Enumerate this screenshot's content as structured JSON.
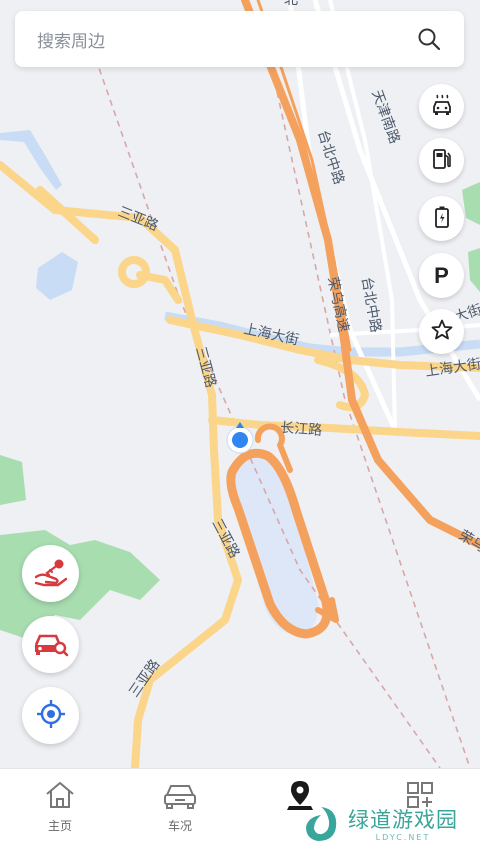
{
  "search": {
    "placeholder": "搜索周边",
    "icon": "search-icon"
  },
  "map": {
    "labels": {
      "tianjin_south": "天津南路",
      "taibei_mid_1": "台北中路",
      "taibei_mid_2": "台北中路",
      "rongwu_highway": "荣乌高速",
      "rongwu_short": "荣乌",
      "sanya_1": "三亚路",
      "sanya_2": "三亚路",
      "sanya_3": "三亚路",
      "sanya_4": "三亚路",
      "shanghai_1": "上海大街",
      "shanghai_2": "上海大街",
      "shanghai_3": "大街",
      "changjiang": "长江路",
      "top_cut": "北"
    },
    "colors": {
      "background": "#eef0f4",
      "highway": "#f5a15e",
      "main_road": "#fbd58a",
      "water": "#c8dcf5",
      "green": "#a8ddb0",
      "location": "#2f86f0"
    }
  },
  "right_tools": [
    {
      "name": "car-wash",
      "icon": "car-wash-icon"
    },
    {
      "name": "fuel",
      "icon": "fuel-pump-icon"
    },
    {
      "name": "charging",
      "icon": "battery-charge-icon"
    },
    {
      "name": "parking",
      "label": "P"
    },
    {
      "name": "favorites",
      "icon": "star-icon"
    }
  ],
  "left_tools": [
    {
      "name": "car-share",
      "icon": "car-key-share-icon"
    },
    {
      "name": "find-car",
      "icon": "car-search-icon"
    },
    {
      "name": "locate",
      "icon": "crosshair-icon"
    }
  ],
  "tabs": [
    {
      "label": "主页",
      "icon": "home-icon"
    },
    {
      "label": "车况",
      "icon": "car-icon"
    },
    {
      "label": "",
      "icon": "map-pin-icon",
      "active": true
    },
    {
      "label": "",
      "icon": "grid-plus-icon"
    }
  ],
  "watermark": {
    "text": "绿道游戏园",
    "sub": "LDYC.NET",
    "logo": "leaf-logo-icon"
  }
}
